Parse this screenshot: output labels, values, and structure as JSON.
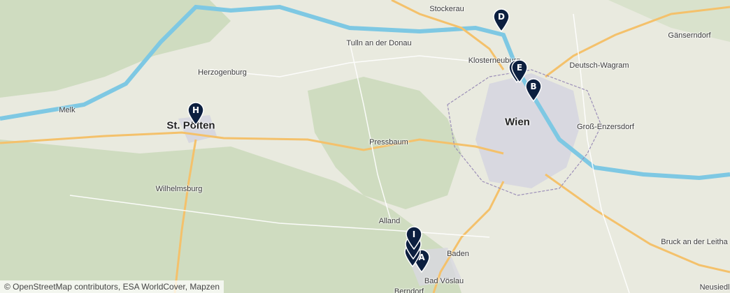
{
  "map": {
    "colors": {
      "land": "#e9eadf",
      "forest": "#cfdcc0",
      "urban": "#d8d8e0",
      "water": "#7ec8e3",
      "motorway": "#f4c16b",
      "road": "#ffffff",
      "border": "#9c8fb8",
      "marker": "#0c1f3f"
    },
    "places": [
      {
        "id": "stockerau",
        "label": "Stockerau"
      },
      {
        "id": "tulln",
        "label": "Tulln an der Donau"
      },
      {
        "id": "klosterneuburg",
        "label": "Klosterneuburg"
      },
      {
        "id": "gaenserndorf",
        "label": "Gänserndorf"
      },
      {
        "id": "deutsch-wagram",
        "label": "Deutsch-Wagram"
      },
      {
        "id": "herzogenburg",
        "label": "Herzogenburg"
      },
      {
        "id": "melk",
        "label": "Melk"
      },
      {
        "id": "st-poelten",
        "label": "St. Pölten"
      },
      {
        "id": "wien",
        "label": "Wien"
      },
      {
        "id": "gross-enzersdorf",
        "label": "Groß-Enzersdorf"
      },
      {
        "id": "pressbaum",
        "label": "Pressbaum"
      },
      {
        "id": "wilhelmsburg",
        "label": "Wilhelmsburg"
      },
      {
        "id": "alland",
        "label": "Alland"
      },
      {
        "id": "baden",
        "label": "Baden"
      },
      {
        "id": "bad-voeslau",
        "label": "Bad Vöslau"
      },
      {
        "id": "bruck",
        "label": "Bruck an der Leitha"
      },
      {
        "id": "neusiedl",
        "label": "Neusiedl"
      },
      {
        "id": "berndorf",
        "label": "Berndorf"
      }
    ],
    "markers": [
      {
        "id": "A",
        "label": "A"
      },
      {
        "id": "B",
        "label": "B"
      },
      {
        "id": "C",
        "label": "C"
      },
      {
        "id": "D",
        "label": "D"
      },
      {
        "id": "E",
        "label": "E"
      },
      {
        "id": "G",
        "label": "G"
      },
      {
        "id": "H",
        "label": "H"
      },
      {
        "id": "I",
        "label": "I"
      }
    ],
    "attribution": "© OpenStreetMap contributors, ESA WorldCover, Mapzen"
  }
}
